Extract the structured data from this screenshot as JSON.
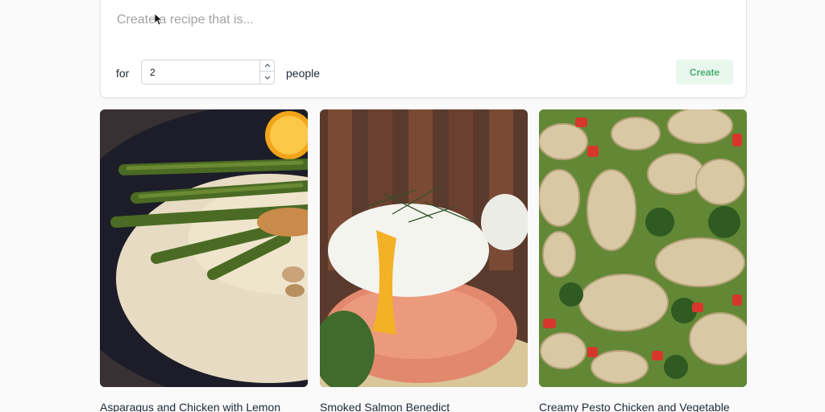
{
  "composer": {
    "prompt_placeholder": "Create a recipe that is...",
    "for_label": "for",
    "servings_value": "2",
    "people_label": "people",
    "create_label": "Create"
  },
  "recipes": [
    {
      "title": "Asparagus and Chicken with Lemon"
    },
    {
      "title": "Smoked Salmon Benedict"
    },
    {
      "title": "Creamy Pesto Chicken and Vegetable"
    }
  ],
  "colors": {
    "create_bg": "#e9f7ee",
    "create_text": "#4caf74"
  }
}
